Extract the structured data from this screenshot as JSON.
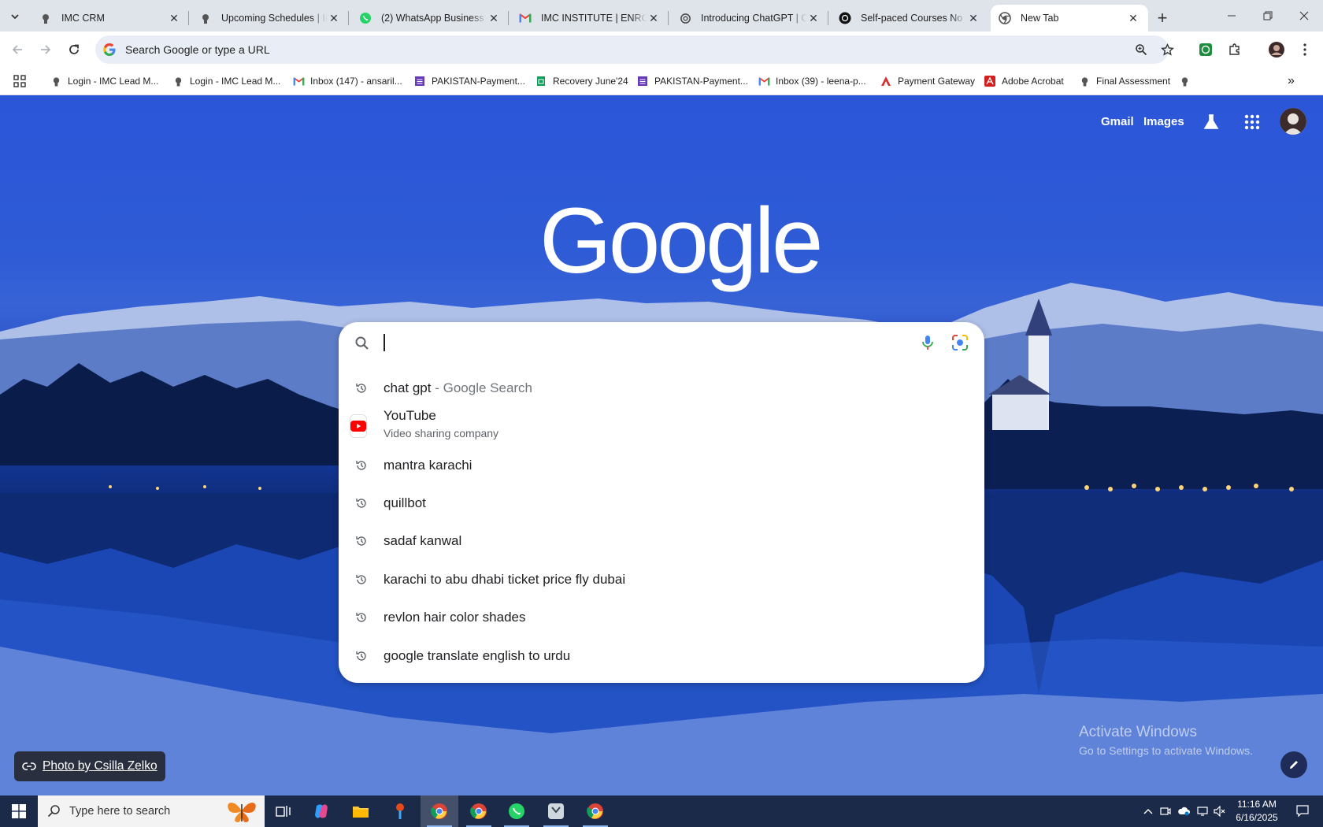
{
  "tabs": [
    {
      "title": "IMC CRM",
      "icon": "imc-logo-icon"
    },
    {
      "title": "Upcoming Schedules | IMC",
      "icon": "imc-logo-icon"
    },
    {
      "title": "(2) WhatsApp Business",
      "icon": "whatsapp-icon"
    },
    {
      "title": "IMC INSTITUTE | ENROLLMENT",
      "icon": "gmail-icon"
    },
    {
      "title": "Introducing ChatGPT | OpenAI",
      "icon": "openai-icon"
    },
    {
      "title": "Self-paced Courses No Limits",
      "icon": "openai-icon"
    },
    {
      "title": "New Tab",
      "icon": "chrome-icon",
      "active": true
    }
  ],
  "omnibox": {
    "placeholder": "Search Google or type a URL"
  },
  "bookmarks": [
    {
      "label": "Login - IMC Lead M...",
      "icon": "imc-logo-icon"
    },
    {
      "label": "Login - IMC Lead M...",
      "icon": "imc-logo-icon"
    },
    {
      "label": "Inbox (147) - ansaril...",
      "icon": "gmail-icon"
    },
    {
      "label": "PAKISTAN-Payment...",
      "icon": "forms-icon"
    },
    {
      "label": "Recovery June'24",
      "icon": "sheets-icon"
    },
    {
      "label": "PAKISTAN-Payment...",
      "icon": "forms-icon"
    },
    {
      "label": "Inbox (39) - leena-p...",
      "icon": "gmail-icon"
    },
    {
      "label": "Payment Gateway",
      "icon": "payment-icon"
    },
    {
      "label": "Adobe Acrobat",
      "icon": "acrobat-icon"
    },
    {
      "label": "Final Assessment",
      "icon": "imc-logo-icon"
    }
  ],
  "ntp": {
    "gmail": "Gmail",
    "images": "Images",
    "logo": "Google",
    "photo_credit": "Photo by Csilla Zelko",
    "activate_title": "Activate Windows",
    "activate_sub": "Go to Settings to activate Windows."
  },
  "suggestions": [
    {
      "text": "chat gpt",
      "suffix": " - Google Search",
      "icon": "history-icon"
    },
    {
      "text": "YouTube",
      "sub": "Video sharing company",
      "icon": "youtube-icon"
    },
    {
      "text": "mantra karachi",
      "icon": "history-icon"
    },
    {
      "text": "quillbot",
      "icon": "history-icon"
    },
    {
      "text": "sadaf kanwal",
      "icon": "history-icon"
    },
    {
      "text": "karachi to abu dhabi ticket price fly dubai",
      "icon": "history-icon"
    },
    {
      "text": "revlon hair color shades",
      "icon": "history-icon"
    },
    {
      "text": "google translate english to urdu",
      "icon": "history-icon"
    }
  ],
  "taskbar": {
    "search_placeholder": "Type here to search",
    "time": "11:16 AM",
    "date": "6/16/2025"
  },
  "colors": {
    "accent": "#1a73e8",
    "ntp_background": "#2b56d8",
    "taskbar": "#1c2a4a"
  }
}
